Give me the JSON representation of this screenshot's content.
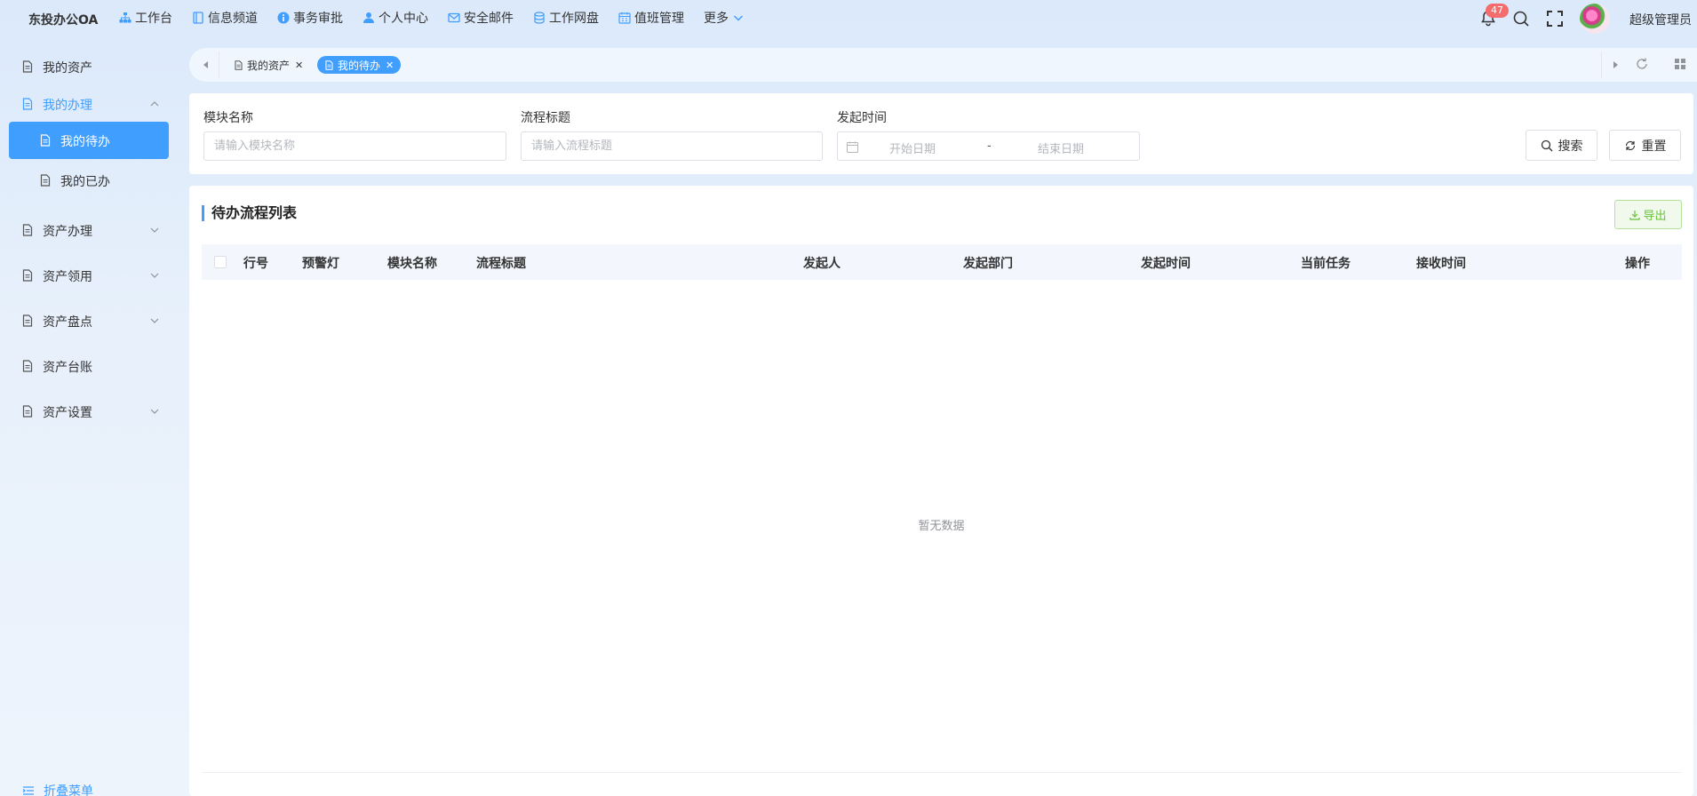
{
  "brand": "东投办公OA",
  "topnav": [
    {
      "label": "工作台",
      "icon": "sitemap-icon"
    },
    {
      "label": "信息频道",
      "icon": "book-icon"
    },
    {
      "label": "事务审批",
      "icon": "info-circle-icon"
    },
    {
      "label": "个人中心",
      "icon": "user-icon"
    },
    {
      "label": "安全邮件",
      "icon": "mail-icon"
    },
    {
      "label": "工作网盘",
      "icon": "database-icon"
    },
    {
      "label": "值班管理",
      "icon": "calendar-icon"
    },
    {
      "label": "更多",
      "icon": "chevron-down-icon"
    }
  ],
  "header": {
    "notification_count": "47",
    "admin_name": "超级管理员"
  },
  "sidebar": {
    "items": [
      {
        "label": "我的资产"
      },
      {
        "label": "我的办理"
      },
      {
        "label": "我的待办"
      },
      {
        "label": "我的已办"
      },
      {
        "label": "资产办理"
      },
      {
        "label": "资产领用"
      },
      {
        "label": "资产盘点"
      },
      {
        "label": "资产台账"
      },
      {
        "label": "资产设置"
      }
    ],
    "collapse_label": "折叠菜单"
  },
  "tabs": [
    {
      "label": "我的资产",
      "active": false
    },
    {
      "label": "我的待办",
      "active": true
    }
  ],
  "search": {
    "module_label": "模块名称",
    "module_placeholder": "请输入模块名称",
    "title_label": "流程标题",
    "title_placeholder": "请输入流程标题",
    "time_label": "发起时间",
    "start_placeholder": "开始日期",
    "separator": "-",
    "end_placeholder": "结束日期",
    "search_btn": "搜索",
    "reset_btn": "重置"
  },
  "table": {
    "title": "待办流程列表",
    "export_btn": "导出",
    "columns": [
      "行号",
      "预警灯",
      "模块名称",
      "流程标题",
      "发起人",
      "发起部门",
      "发起时间",
      "当前任务",
      "接收时间",
      "操作"
    ],
    "rows": [],
    "empty_text": "暂无数据"
  },
  "colors": {
    "primary": "#409eff",
    "success": "#67c23a",
    "danger": "#f56c6c"
  }
}
